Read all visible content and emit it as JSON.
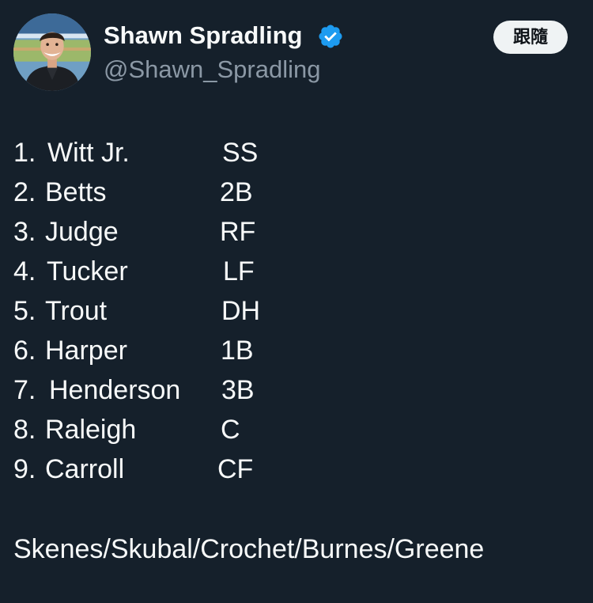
{
  "author": {
    "display_name": "Shawn Spradling",
    "handle": "@Shawn_Spradling",
    "verified": true,
    "avatar_icon": "profile-photo-icon",
    "verified_icon": "verified-badge-icon"
  },
  "actions": {
    "follow_label": "跟隨"
  },
  "lineup": [
    {
      "num": "1.",
      "player": "Witt Jr.",
      "pos": "SS"
    },
    {
      "num": "2.",
      "player": "Betts",
      "pos": "2B"
    },
    {
      "num": "3.",
      "player": "Judge",
      "pos": "RF"
    },
    {
      "num": "4.",
      "player": "Tucker",
      "pos": "LF"
    },
    {
      "num": "5.",
      "player": "Trout",
      "pos": "DH"
    },
    {
      "num": "6.",
      "player": "Harper",
      "pos": "1B"
    },
    {
      "num": "7.",
      "player": "Henderson",
      "pos": "3B"
    },
    {
      "num": "8.",
      "player": "Raleigh",
      "pos": "C"
    },
    {
      "num": "9.",
      "player": "Carroll",
      "pos": "CF"
    }
  ],
  "pitchers": "Skenes/Skubal/Crochet/Burnes/Greene",
  "colors": {
    "background": "#15202b",
    "text": "#f7f9f9",
    "secondary_text": "#8b98a5",
    "verified": "#1d9bf0",
    "follow_button_bg": "#eff3f4"
  }
}
